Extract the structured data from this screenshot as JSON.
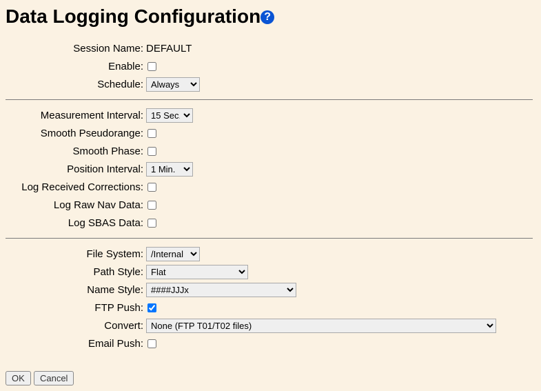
{
  "title": "Data Logging Configuration",
  "help_icon_char": "?",
  "fields": {
    "session_name": {
      "label": "Session Name:",
      "value": "DEFAULT"
    },
    "enable": {
      "label": "Enable:"
    },
    "schedule": {
      "label": "Schedule:",
      "value": "Always"
    },
    "measurement_interval": {
      "label": "Measurement Interval:",
      "value": "15 Sec."
    },
    "smooth_pseudorange": {
      "label": "Smooth Pseudorange:"
    },
    "smooth_phase": {
      "label": "Smooth Phase:"
    },
    "position_interval": {
      "label": "Position Interval:",
      "value": "1 Min."
    },
    "log_received_corrections": {
      "label": "Log Received Corrections:"
    },
    "log_raw_nav": {
      "label": "Log Raw Nav Data:"
    },
    "log_sbas": {
      "label": "Log SBAS Data:"
    },
    "file_system": {
      "label": "File System:",
      "value": "/Internal"
    },
    "path_style": {
      "label": "Path Style:",
      "value": "Flat"
    },
    "name_style": {
      "label": "Name Style:",
      "value": "####JJJx"
    },
    "ftp_push": {
      "label": "FTP Push:"
    },
    "convert": {
      "label": "Convert:",
      "value": "None (FTP T01/T02 files)"
    },
    "email_push": {
      "label": "Email Push:"
    }
  },
  "buttons": {
    "ok": "OK",
    "cancel": "Cancel"
  }
}
